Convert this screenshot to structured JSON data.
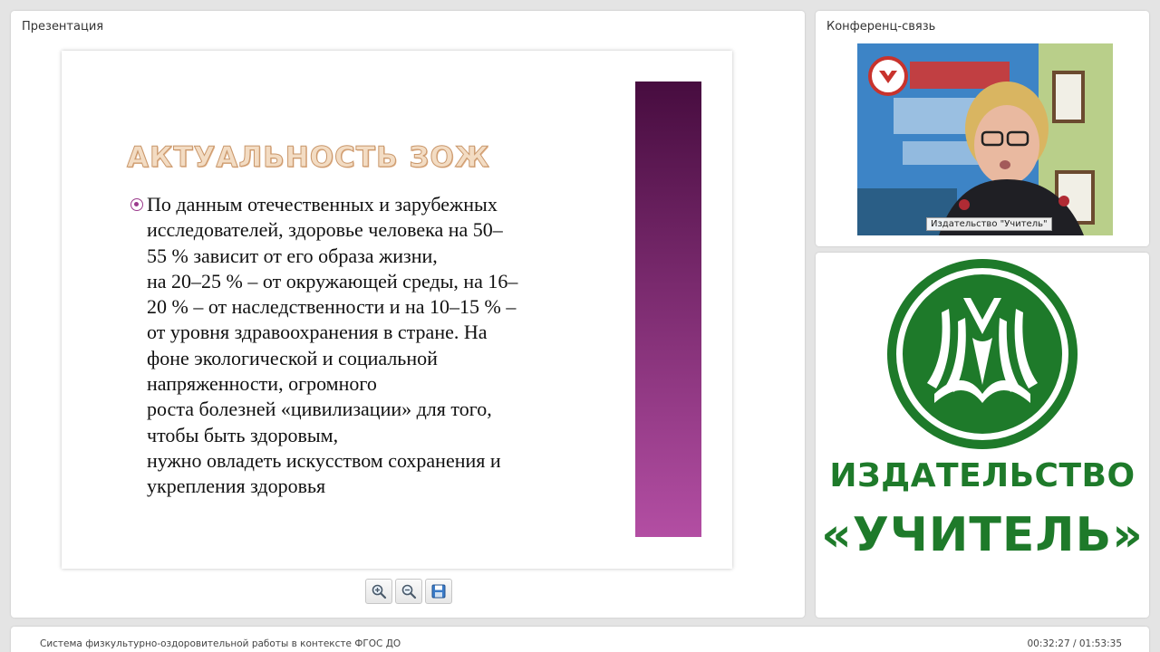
{
  "presentation": {
    "title": "Презентация",
    "slide": {
      "heading": "АКТУАЛЬНОСТЬ ЗОЖ",
      "body_lines": [
        "По данным отечественных и зарубежных",
        "исследователей, здоровье человека на 50–",
        "55 % зависит от его образа жизни,",
        "на 20–25 % – от окружающей среды, на 16–",
        "20 % – от наследственности и на 10–15 % –",
        "от уровня здравоохранения в стране. На",
        "фоне экологической и социальной",
        "напряженности, огромного",
        "роста болезней «цивилизации» для того,",
        "чтобы быть здоровым,",
        "нужно овладеть искусством сохранения и",
        "укрепления здоровья"
      ],
      "bullet_color": "#9b3b8c",
      "stripe_colors": [
        "#470c3f",
        "#b34ea3"
      ]
    },
    "toolbar": {
      "zoom_in_icon": "zoom-in-icon",
      "zoom_out_icon": "zoom-out-icon",
      "save_icon": "save-icon"
    }
  },
  "conference": {
    "title": "Конференц-связь",
    "video_label": "Издательство \"Учитель\""
  },
  "logo_panel": {
    "name": "ИЗДАТЕЛЬСТВО",
    "quote": "«УЧИТЕЛЬ»",
    "brand_color": "#1e7a2a"
  },
  "footer": {
    "title": "Система физкультурно-оздоровительной работы в контексте ФГОС ДО",
    "time": "00:32:27 / 01:53:35"
  }
}
